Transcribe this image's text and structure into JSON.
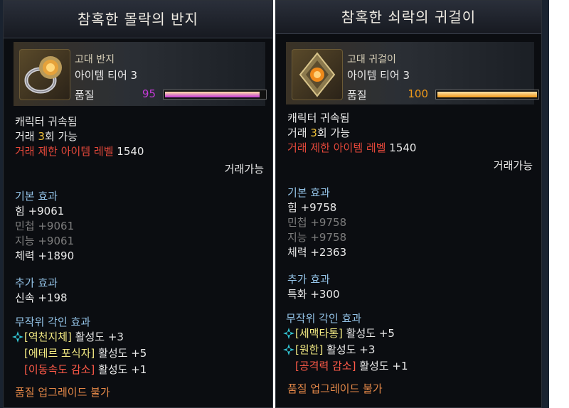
{
  "left": {
    "title": "참혹한 몰락의 반지",
    "item_type": "고대 반지",
    "tier": "아이템 티어 3",
    "quality_label": "품질",
    "quality_value": "95",
    "quality_fraction": 0.95,
    "quality_color": "#c43ad6",
    "bind": "캐릭터 귀속됨",
    "trade_pre": "거래 ",
    "trade_count": "3",
    "trade_post": "회 가능",
    "trade_limit_label": "거래 제한 아이템 레벨",
    "trade_limit_value": "1540",
    "tradeable": "거래가능",
    "base_header": "기본 효과",
    "base": [
      "힘 +9061",
      "민첩 +9061",
      "지능 +9061",
      "체력 +1890"
    ],
    "extra_header": "추가 효과",
    "extra": [
      "신속 +198"
    ],
    "engrave_header": "무작위 각인 효과",
    "engravings": [
      {
        "name": "[역천지체]",
        "suffix": " 활성도 +3",
        "has_icon": true,
        "color": "yellow"
      },
      {
        "name": "[에테르 포식자]",
        "suffix": " 활성도 +5",
        "has_icon": false,
        "color": "yellow"
      },
      {
        "name": "[이동속도 감소]",
        "suffix": " 활성도 +1",
        "has_icon": false,
        "color": "red"
      }
    ],
    "footer": "품질 업그레이드 불가"
  },
  "right": {
    "title": "참혹한 쇠락의 귀걸이",
    "item_type": "고대 귀걸이",
    "tier": "아이템 티어 3",
    "quality_label": "품질",
    "quality_value": "100",
    "quality_fraction": 1.0,
    "quality_color": "#f09a1a",
    "bind": "캐릭터 귀속됨",
    "trade_pre": "거래 ",
    "trade_count": "3",
    "trade_post": "회 가능",
    "trade_limit_label": "거래 제한 아이템 레벨",
    "trade_limit_value": "1540",
    "tradeable": "거래가능",
    "base_header": "기본 효과",
    "base": [
      "힘 +9758",
      "민첩 +9758",
      "지능 +9758",
      "체력 +2363"
    ],
    "extra_header": "추가 효과",
    "extra": [
      "특화 +300"
    ],
    "engrave_header": "무작위 각인 효과",
    "engravings": [
      {
        "name": "[세맥타통]",
        "suffix": " 활성도 +5",
        "has_icon": true,
        "color": "yellow"
      },
      {
        "name": "[원한]",
        "suffix": " 활성도 +3",
        "has_icon": true,
        "color": "yellow"
      },
      {
        "name": "[공격력 감소]",
        "suffix": " 활성도 +1",
        "has_icon": false,
        "color": "red"
      }
    ],
    "footer": "품질 업그레이드 불가"
  },
  "colors": {
    "gold": "#f2c33b",
    "red_label": "#e5483a",
    "section": "#93c2e6",
    "dim": "#7c7c7c",
    "footer": "#e48848"
  }
}
